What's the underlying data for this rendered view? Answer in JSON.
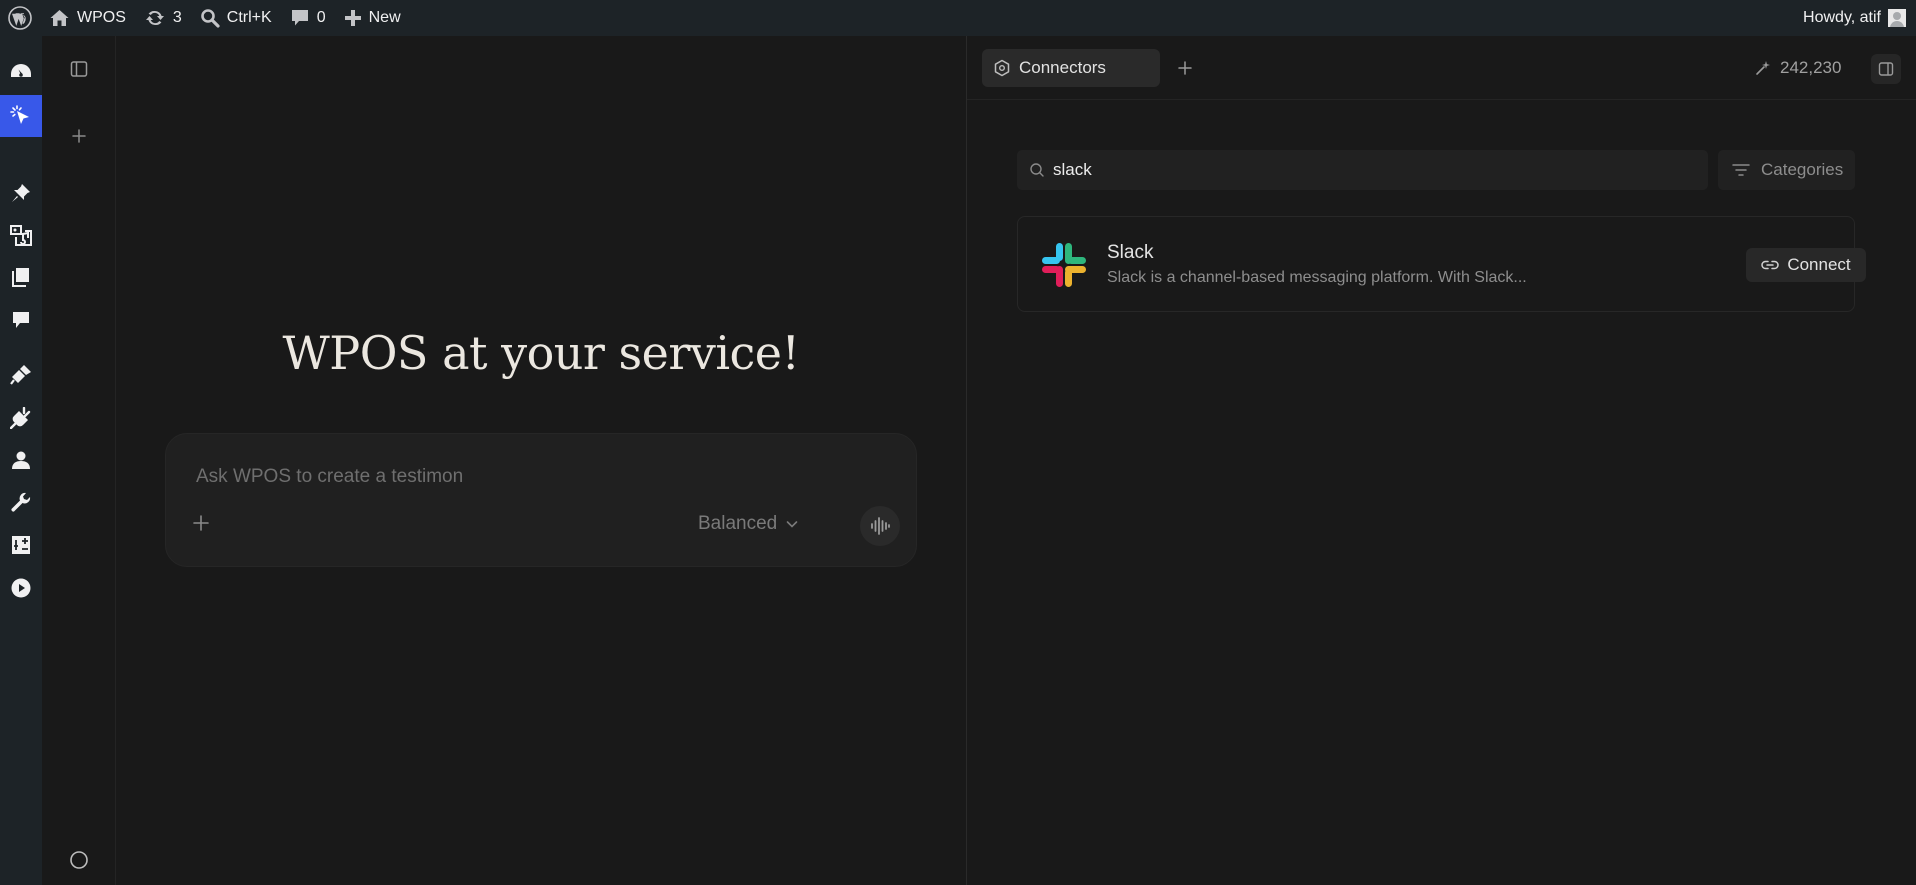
{
  "adminbar": {
    "site_name": "WPOS",
    "updates_count": "3",
    "search_shortcut": "Ctrl+K",
    "comments_count": "0",
    "new_label": "New",
    "greeting": "Howdy, atif"
  },
  "admin_menu": {
    "icons": [
      "dashboard-icon",
      "wpos-cursor-icon",
      "posts-pin-icon",
      "media-icon",
      "pages-icon",
      "comments-icon",
      "appearance-brush-icon",
      "plugins-icon",
      "users-icon",
      "tools-wrench-icon",
      "settings-icon",
      "play-icon"
    ],
    "active": "wpos-cursor-icon"
  },
  "main": {
    "hero_title": "WPOS at your service!",
    "prompt_placeholder": "Ask WPOS to create a testimon",
    "mode_label": "Balanced"
  },
  "panel": {
    "tab_label": "Connectors",
    "credits": "242,230",
    "search_value": "slack",
    "categories_label": "Categories",
    "connectors": [
      {
        "name": "Slack",
        "description": "Slack is a channel-based messaging platform. With Slack...",
        "action": "Connect"
      }
    ]
  },
  "colors": {
    "accent": "#3858e9",
    "background": "#191919",
    "adminbar": "#1d2327"
  }
}
